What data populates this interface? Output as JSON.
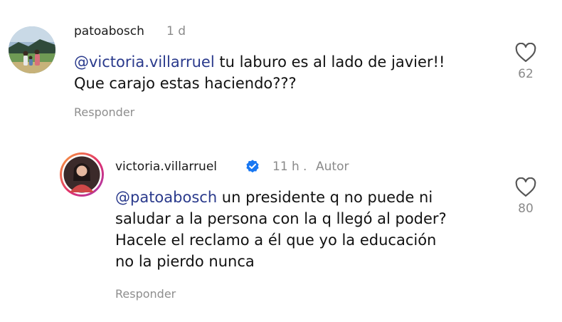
{
  "comments": [
    {
      "username": "patoabosch",
      "time": "1 d",
      "text_lines": [
        {
          "mention": "@victoria.villarruel",
          "rest": " tu laburo es al lado de javier!!"
        },
        {
          "mention": "",
          "rest": "Que carajo estas haciendo???"
        }
      ],
      "reply_label": "Responder",
      "likes": "62",
      "avatar_icon": "landscape-photo-avatar"
    },
    {
      "username": "victoria.villarruel",
      "verified": true,
      "time": "11 h",
      "separator": ".",
      "author_tag": "Autor",
      "text_lines": [
        {
          "mention": "@patoabosch",
          "rest": " un presidente q no puede ni"
        },
        {
          "mention": "",
          "rest": "saludar a la persona con la q llegó al poder?"
        },
        {
          "mention": "",
          "rest": "Hacele el reclamo a él que yo la educación"
        },
        {
          "mention": "",
          "rest": "no la pierdo nunca"
        }
      ],
      "reply_label": "Responder",
      "likes": "80",
      "avatar_icon": "profile-photo-avatar-with-story-ring"
    }
  ],
  "colors": {
    "mention": "#2a3a8c",
    "meta": "#8a8a8a",
    "verified": "#1877f2",
    "story_ring": "#e1306c"
  }
}
